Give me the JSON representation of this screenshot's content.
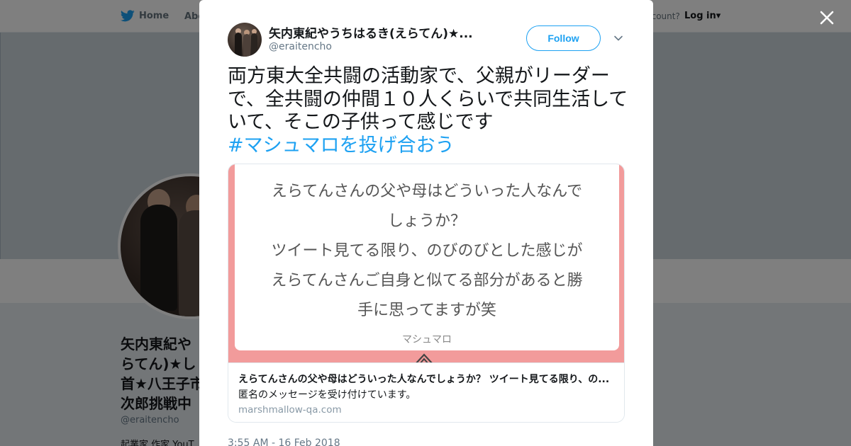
{
  "background": {
    "nav": {
      "home_label": "Home",
      "about_label": "Abo",
      "account_prompt": "ccount?",
      "login_label": "Log in"
    },
    "profile": {
      "name_lines": [
        "矢内東紀や",
        "らてん)★し",
        "首★八王子市",
        "次郎挑戦中"
      ],
      "handle": "@eraitencho",
      "bio": "起業家 作家 YouT"
    }
  },
  "modal": {
    "author": {
      "name": "矢内東紀やうちはるき(えらてん)★...",
      "handle": "@eraitencho"
    },
    "follow_label": "Follow",
    "tweet": {
      "text": "両方東大全共闘の活動家で、父親がリーダーで、全共闘の仲間１０人くらいで共同生活していて、そこの子供って感じです",
      "hashtag": "#マシュマロを投げ合おう"
    },
    "card": {
      "image_lines": [
        "えらてんさんの父や母はどういった人なんで",
        "しょうか？",
        "ツイート見てる限り、のびのびとした感じが",
        "えらてんさんご自身と似てる部分があると勝",
        "手に思ってますが笑"
      ],
      "image_brand": "マシュマロ",
      "title": "えらてんさんの父や母はどういった人なんでしょうか？ ツイート見てる限り、の...",
      "description": "匿名のメッセージを受け付けています。",
      "domain": "marshmallow-qa.com"
    },
    "timestamp": "3:55 AM - 16 Feb 2018"
  },
  "colors": {
    "accent": "#1da1f2",
    "card_border_pink": "#f29b9b",
    "overlay": "rgba(0,0,0,0.5)"
  },
  "icons": [
    "twitter-bird-icon",
    "close-icon",
    "chevron-down-icon",
    "marshmallow-logo-icon"
  ]
}
